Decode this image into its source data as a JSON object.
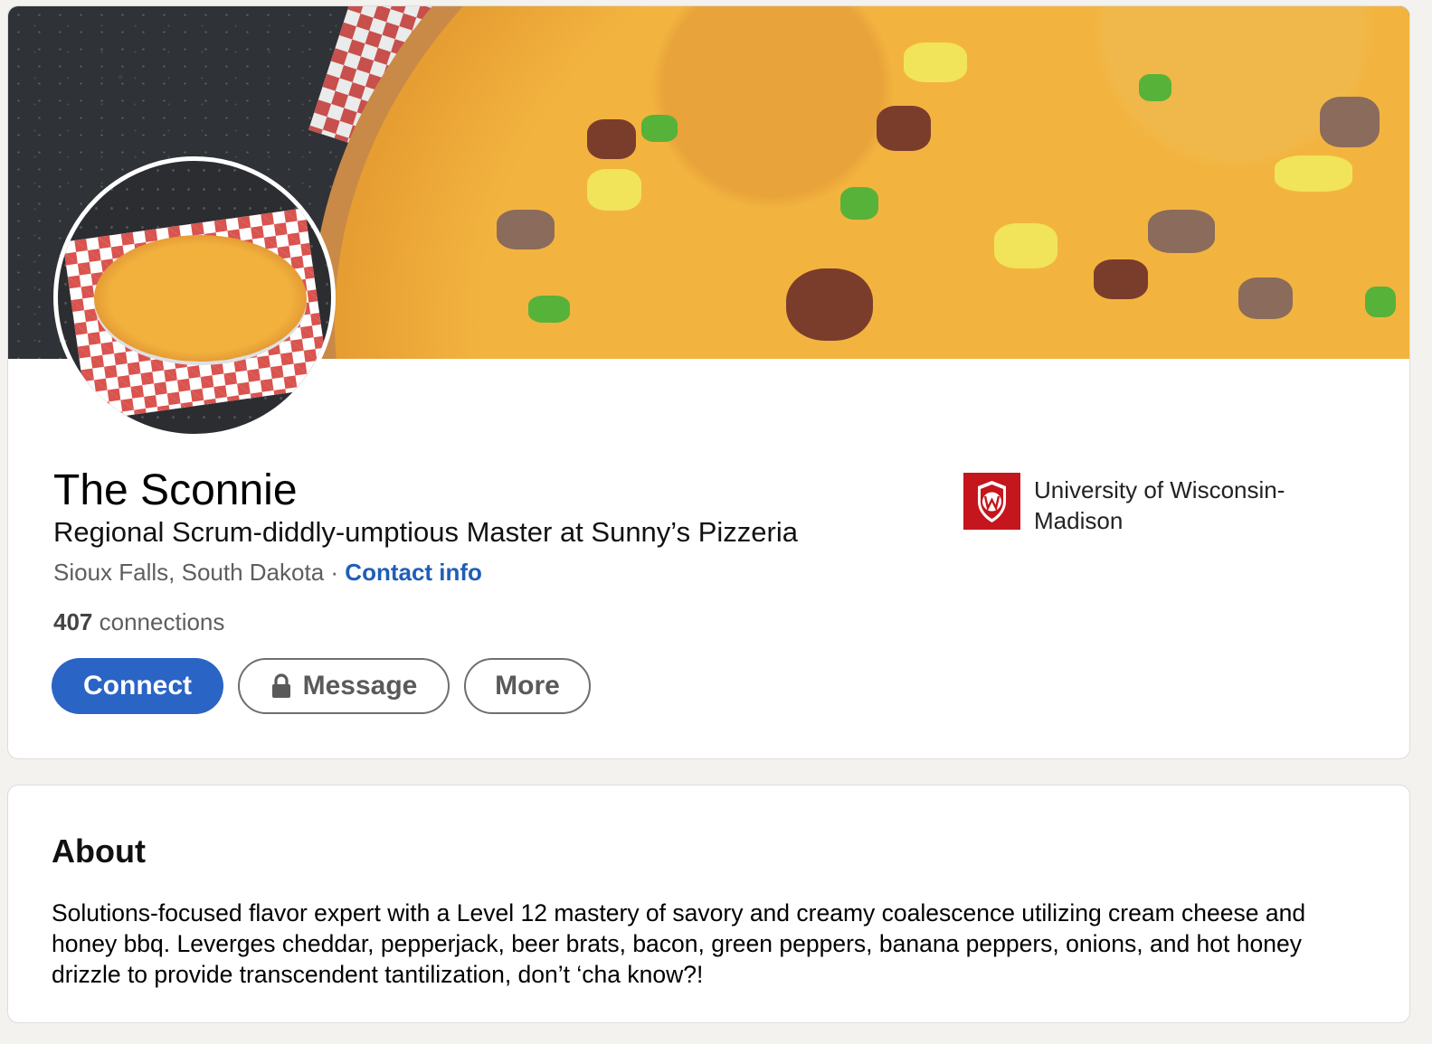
{
  "profile": {
    "name": "The Sconnie",
    "headline": "Regional Scrum-diddly-umptious Master at Sunny’s Pizzeria",
    "location": "Sioux Falls, South Dakota",
    "separator": "·",
    "contact_label": "Contact info",
    "connections_count": "407",
    "connections_label": "connections"
  },
  "actions": {
    "connect_label": "Connect",
    "message_label": "Message",
    "more_label": "More"
  },
  "education": {
    "school_name": "University of Wisconsin-Madison"
  },
  "about": {
    "title": "About",
    "text": "Solutions-focused flavor expert with a Level 12 mastery of savory and creamy coalescence utilizing cream cheese and honey bbq. Leverges cheddar, pepperjack, beer brats, bacon, green peppers, banana peppers, onions, and hot honey drizzle to provide transcendent tantilization, don’t ‘cha know?!"
  },
  "colors": {
    "accent": "#2a64c5",
    "link": "#1f5eb8",
    "school_logo": "#c4161c",
    "page_bg": "#f3f2ef"
  },
  "icons": {
    "lock": "lock-icon",
    "school": "uw-madison-crest-icon"
  }
}
